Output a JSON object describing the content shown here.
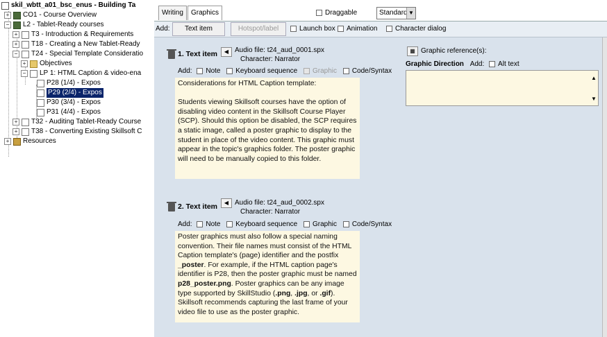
{
  "tree": {
    "root": "skil_wbtt_a01_bsc_enus - Building Ta",
    "co1": "CO1 - Course Overview",
    "l2": "L2 - Tablet-Ready courses",
    "t3": "T3 - Introduction & Requirements",
    "t18": "T18 - Creating a New Tablet-Ready",
    "t24": "T24 - Special Template Consideratio",
    "objectives": "Objectives",
    "lp1": "LP 1: HTML Caption & video-ena",
    "p28": "P28 (1/4) - Expos",
    "p29": "P29 (2/4) - Expos",
    "p30": "P30 (3/4) - Expos",
    "p31": "P31 (4/4) - Expos",
    "t32": "T32 - Auditing Tablet-Ready Course",
    "t38": "T38 - Converting Existing Skillsoft C",
    "resources": "Resources"
  },
  "tabs": {
    "writing": "Writing",
    "graphics": "Graphics"
  },
  "toolbar": {
    "draggable": "Draggable",
    "mode": "Standard"
  },
  "addbar": {
    "add": "Add:",
    "text_item": "Text item",
    "hotspot": "Hotspot/label",
    "launch_box": "Launch box",
    "animation": "Animation",
    "character_dialog": "Character dialog"
  },
  "item1": {
    "title": "1. Text item",
    "audio": "Audio file:  t24_aud_0001.spx",
    "character": "Character:  Narrator",
    "add": "Add:",
    "note": "Note",
    "keyboard": "Keyboard sequence",
    "graphic": "Graphic",
    "code": "Code/Syntax",
    "text": "Considerations for HTML Caption template:\n\nStudents viewing Skillsoft courses have the option of disabling video content in the Skillsoft Course Player (SCP). Should this option be disabled, the SCP requires a static image, called a poster graphic to display to the student in place of the video content. This graphic must appear in the topic's graphics folder. The poster graphic will need to be manually copied to this folder."
  },
  "item2": {
    "title": "2. Text item",
    "audio": "Audio file:  t24_aud_0002.spx",
    "character": "Character:  Narrator",
    "add": "Add:",
    "note": "Note",
    "keyboard": "Keyboard sequence",
    "graphic": "Graphic",
    "code": "Code/Syntax",
    "text_a": "Poster graphics must also follow a special naming convention.  Their file names must consist of the HTML Caption template's (page) identifier and the postfix ",
    "text_b": "_poster",
    "text_c": ". For example, if the HTML caption page's identifier is P28, then the poster graphic must be named ",
    "text_d": "p28_poster.png",
    "text_e": ". Poster graphics can be any image type supported by SkillStudio (",
    "text_f": ".png",
    "text_g": ", ",
    "text_h": ".jpg",
    "text_i": ", or ",
    "text_j": ".gif",
    "text_k": "). Skillsoft recommends capturing the last frame of your video file to use as the poster graphic."
  },
  "graphics": {
    "reference": "Graphic reference(s):",
    "direction": "Graphic Direction",
    "add": "Add:",
    "alt_text": "Alt text"
  }
}
